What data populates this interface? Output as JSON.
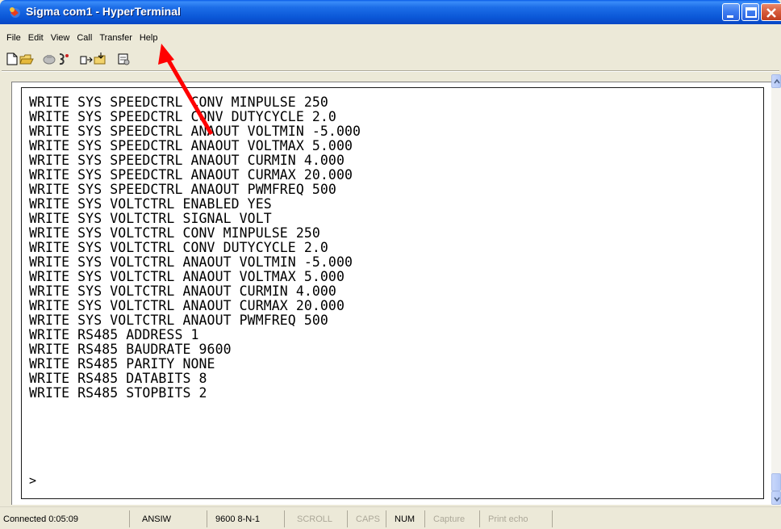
{
  "window": {
    "title": "Sigma com1 - HyperTerminal"
  },
  "menu": [
    "File",
    "Edit",
    "View",
    "Call",
    "Transfer",
    "Help"
  ],
  "toolbar": {
    "buttons": [
      "new-icon",
      "open-icon",
      "disconnect-icon",
      "dial-icon",
      "send-icon",
      "receive-icon",
      "properties-icon"
    ]
  },
  "terminal": {
    "lines": [
      "WRITE SYS SPEEDCTRL CONV MINPULSE 250",
      "WRITE SYS SPEEDCTRL CONV DUTYCYCLE 2.0",
      "WRITE SYS SPEEDCTRL ANAOUT VOLTMIN -5.000",
      "WRITE SYS SPEEDCTRL ANAOUT VOLTMAX 5.000",
      "WRITE SYS SPEEDCTRL ANAOUT CURMIN 4.000",
      "WRITE SYS SPEEDCTRL ANAOUT CURMAX 20.000",
      "WRITE SYS SPEEDCTRL ANAOUT PWMFREQ 500",
      "WRITE SYS VOLTCTRL ENABLED YES",
      "WRITE SYS VOLTCTRL SIGNAL VOLT",
      "WRITE SYS VOLTCTRL CONV MINPULSE 250",
      "WRITE SYS VOLTCTRL CONV DUTYCYCLE 2.0",
      "WRITE SYS VOLTCTRL ANAOUT VOLTMIN -5.000",
      "WRITE SYS VOLTCTRL ANAOUT VOLTMAX 5.000",
      "WRITE SYS VOLTCTRL ANAOUT CURMIN 4.000",
      "WRITE SYS VOLTCTRL ANAOUT CURMAX 20.000",
      "WRITE SYS VOLTCTRL ANAOUT PWMFREQ 500",
      "WRITE RS485 ADDRESS 1",
      "WRITE RS485 BAUDRATE 9600",
      "WRITE RS485 PARITY NONE",
      "WRITE RS485 DATABITS 8",
      "WRITE RS485 STOPBITS 2"
    ],
    "prompt": ">"
  },
  "status": {
    "connected": "Connected 0:05:09",
    "emulation": "ANSIW",
    "settings": "9600 8-N-1",
    "scroll": "SCROLL",
    "caps": "CAPS",
    "num": "NUM",
    "capture": "Capture",
    "print_echo": "Print echo"
  },
  "colors": {
    "annotation_arrow": "#ff0000",
    "titlebar": "#0b58d8"
  }
}
